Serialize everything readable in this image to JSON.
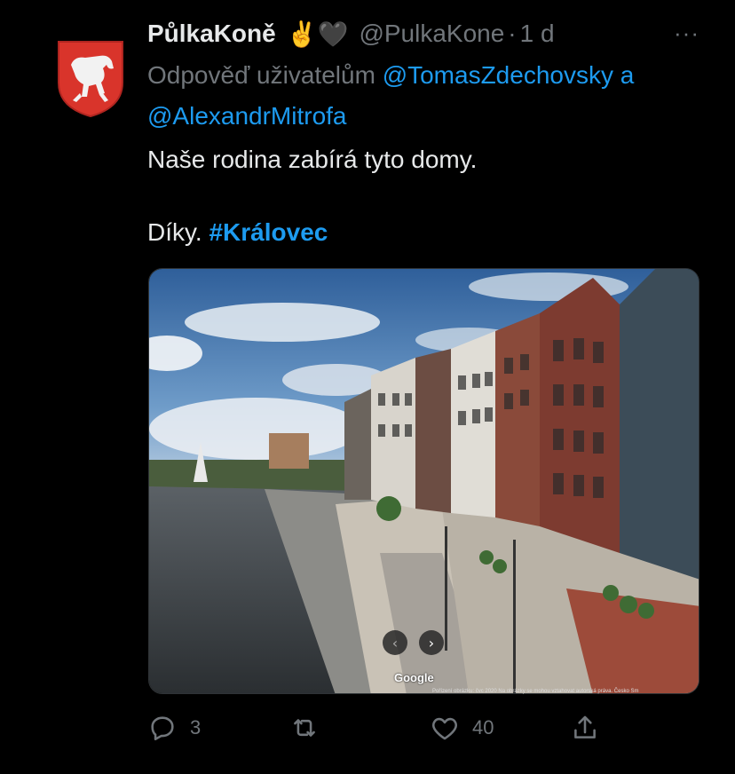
{
  "tweet": {
    "author_name": "PůlkaKoně",
    "author_emojis": "✌️🖤",
    "author_handle": "@PulkaKone",
    "separator": "·",
    "time": "1 d",
    "more": "···",
    "reply_prefix": "Odpověď uživatelům ",
    "reply_mention_1": "@TomasZdechovsky",
    "reply_connector": " a",
    "reply_mention_2": "@AlexandrMitrofa",
    "text_line_1": "Naše rodina zabírá tyto domy.",
    "text_line_2_prefix": "Díky. ",
    "hashtag": "#Královec"
  },
  "media": {
    "watermark": "Google",
    "copyright": "Pořízení obrázku: čvc 2020    Na obrázky se mohou vztahovat autorská práva.    Česko    Sm",
    "prev_icon": "‹",
    "next_icon": "›"
  },
  "actions": {
    "reply_count": "3",
    "retweet_count": "",
    "like_count": "40"
  },
  "colors": {
    "background": "#000000",
    "link": "#1d9bf0",
    "muted": "#71767b",
    "text": "#e7e9ea"
  }
}
